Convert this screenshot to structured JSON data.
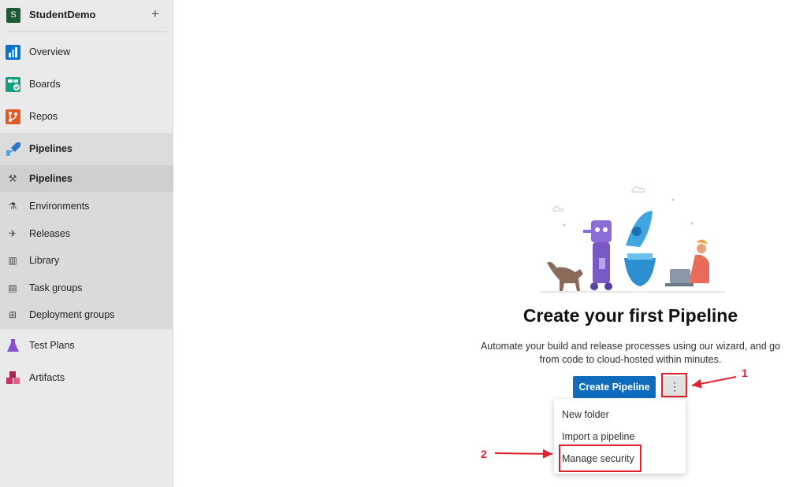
{
  "project": {
    "avatar_letter": "S",
    "name": "StudentDemo",
    "add_glyph": "+"
  },
  "sidebar": {
    "items": [
      {
        "label": "Overview",
        "icon": "overview-icon",
        "color": "#0078d4"
      },
      {
        "label": "Boards",
        "icon": "boards-icon",
        "color": "#009c7c"
      },
      {
        "label": "Repos",
        "icon": "repos-icon",
        "color": "#e05a26"
      },
      {
        "label": "Pipelines",
        "icon": "pipelines-icon",
        "color": "#2f75c7"
      },
      {
        "label": "Test Plans",
        "icon": "test-plans-icon",
        "color": "#8a4fcf"
      },
      {
        "label": "Artifacts",
        "icon": "artifacts-icon",
        "color": "#c8326b"
      }
    ],
    "pipelines_sub": [
      {
        "label": "Pipelines",
        "icon": "pipelines-sub-icon"
      },
      {
        "label": "Environments",
        "icon": "environments-icon"
      },
      {
        "label": "Releases",
        "icon": "releases-icon"
      },
      {
        "label": "Library",
        "icon": "library-icon"
      },
      {
        "label": "Task groups",
        "icon": "task-groups-icon"
      },
      {
        "label": "Deployment groups",
        "icon": "deployment-groups-icon"
      }
    ]
  },
  "main": {
    "title": "Create your first Pipeline",
    "description": "Automate your build and release processes using our wizard, and go from code to cloud-hosted within minutes.",
    "create_button": "Create Pipeline",
    "more_glyph": "⋮",
    "menu": [
      "New folder",
      "Import a pipeline",
      "Manage security"
    ]
  },
  "annotations": {
    "callout_1": "1",
    "callout_2": "2",
    "color": "#e0202a"
  }
}
